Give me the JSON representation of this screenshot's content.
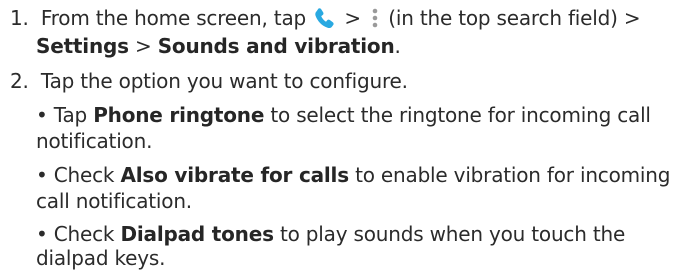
{
  "colors": {
    "text": "#2b2b2b",
    "phone_icon": "#29a9e1",
    "dots_icon": "#9a9a9a"
  },
  "icons": [
    "phone-icon",
    "vertical-dots-icon"
  ],
  "step1": {
    "number": "1.",
    "line1_a": "From the home screen, tap",
    "line1_b": ">",
    "line1_c": "(in the top search field) >",
    "settings": "Settings",
    "sep": ">",
    "sounds": "Sounds and vibration",
    "period": "."
  },
  "step2": {
    "number": "2.",
    "text": "Tap the option you want to configure."
  },
  "bullets": [
    {
      "bullet": "•",
      "lead": "Tap",
      "bold": "Phone ringtone",
      "rest_line1": "to select the ringtone for incoming call",
      "rest_line2": "notification."
    },
    {
      "bullet": "•",
      "lead": "Check",
      "bold": "Also vibrate for calls",
      "rest_line1": "to enable vibration for incoming",
      "rest_line2": "call notification."
    },
    {
      "bullet": "•",
      "lead": "Check",
      "bold": "Dialpad tones",
      "rest_line1": "to play sounds when you touch the",
      "rest_line2": "dialpad keys."
    }
  ]
}
